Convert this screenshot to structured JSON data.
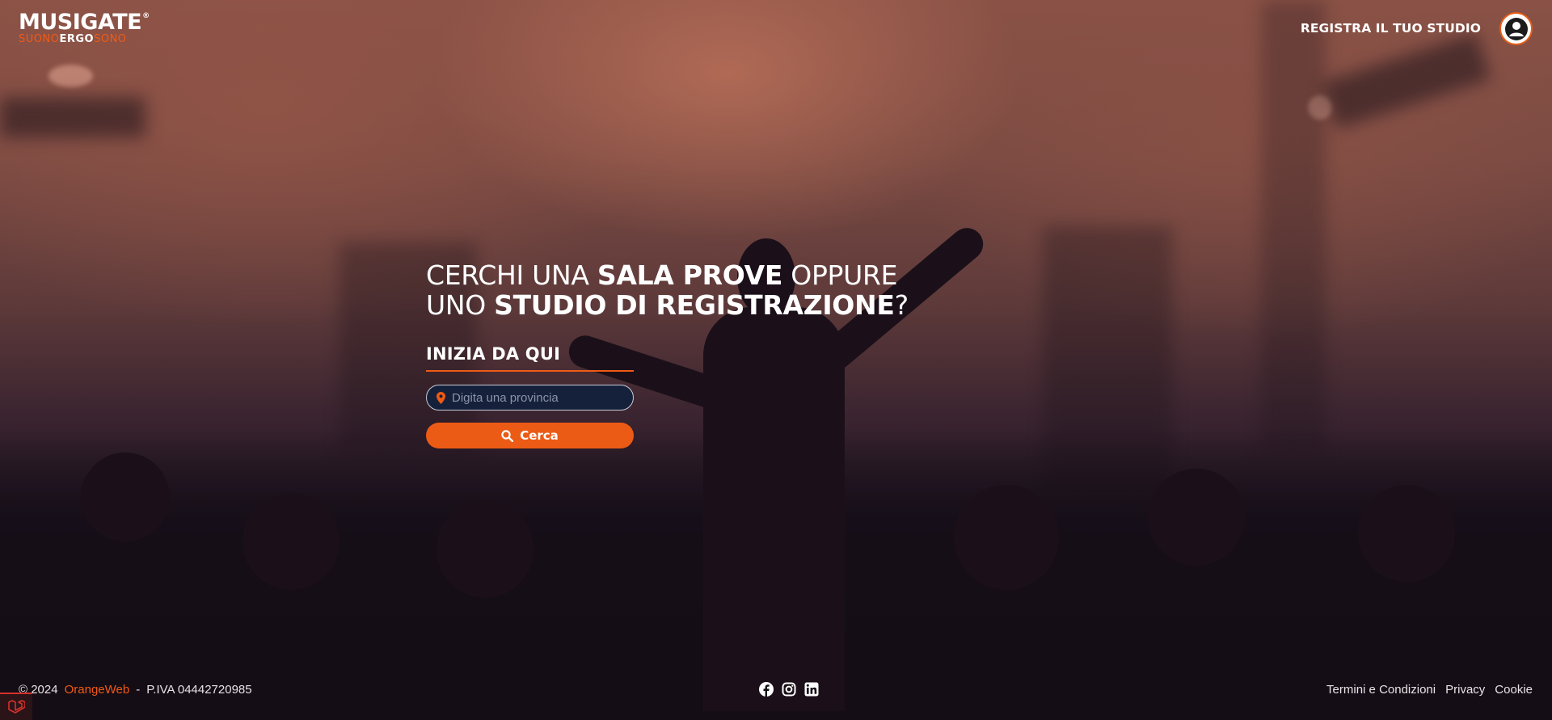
{
  "header": {
    "logo_main": "MUSIGATE",
    "logo_reg": "®",
    "logo_sub": [
      "SUONO",
      "ERGO",
      "SONO"
    ],
    "register_label": "REGISTRA IL TUO STUDIO",
    "user_icon": "user-circle-icon"
  },
  "hero": {
    "title_line1_a": "CERCHI UNA ",
    "title_line1_b": "SALA PROVE",
    "title_line1_c": " OPPURE",
    "title_line2_a": "UNO ",
    "title_line2_b": "STUDIO DI REGISTRAZIONE",
    "title_line2_c": "?",
    "start_label": "INIZIA DA QUI",
    "search_placeholder": "Digita una provincia",
    "search_value": "",
    "search_button": "Cerca"
  },
  "footer": {
    "copyright": "© 2024",
    "brand": "OrangeWeb",
    "separator": "-",
    "vat": "P.IVA 04442720985",
    "social": [
      "facebook-icon",
      "instagram-icon",
      "linkedin-icon"
    ],
    "links": [
      "Termini e Condizioni",
      "Privacy",
      "Cookie"
    ]
  },
  "colors": {
    "accent": "#f05a14",
    "input_bg": "#15213a",
    "text": "#ffffff"
  }
}
